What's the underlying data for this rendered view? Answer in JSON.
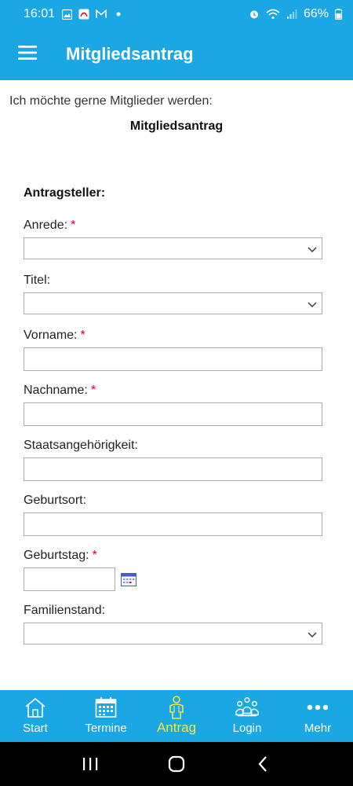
{
  "status_bar": {
    "time": "16:01",
    "battery": "66%"
  },
  "app_bar": {
    "title": "Mitgliedsantrag",
    "menu_icon": "hamburger-menu-icon"
  },
  "content": {
    "intro": "Ich möchte gerne Mitglieder werden:",
    "form_title": "Mitgliedsantrag",
    "section_title": "Antragsteller:",
    "required_marker": "*",
    "fields": {
      "anrede": {
        "label": "Anrede:",
        "value": ""
      },
      "titel": {
        "label": "Titel:",
        "value": ""
      },
      "vorname": {
        "label": "Vorname:",
        "value": ""
      },
      "nachname": {
        "label": "Nachname:",
        "value": ""
      },
      "staatsangehoerigkeit": {
        "label": "Staatsangehörigkeit:",
        "value": ""
      },
      "geburtsort": {
        "label": "Geburtsort:",
        "value": ""
      },
      "geburtstag": {
        "label": "Geburtstag:",
        "value": ""
      },
      "familienstand": {
        "label": "Familienstand:",
        "value": ""
      }
    }
  },
  "bottom_nav": {
    "items": [
      {
        "label": "Start",
        "icon": "home-icon",
        "active": false
      },
      {
        "label": "Termine",
        "icon": "calendar-icon",
        "active": false
      },
      {
        "label": "Antrag",
        "icon": "person-icon",
        "active": true
      },
      {
        "label": "Login",
        "icon": "group-icon",
        "active": false
      },
      {
        "label": "Mehr",
        "icon": "more-dots-icon",
        "active": false
      }
    ]
  },
  "colors": {
    "primary": "#1aa7e4",
    "active_nav": "#f5e642",
    "required": "#d9001b"
  }
}
